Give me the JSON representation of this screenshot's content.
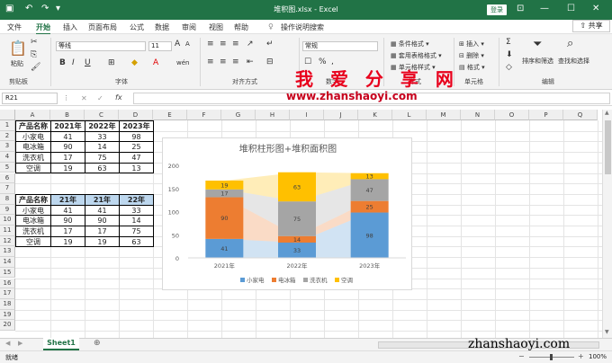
{
  "titlebar": {
    "title": "堆积图.xlsx - Excel",
    "login": "登录"
  },
  "menu": {
    "items": [
      "文件",
      "开始",
      "插入",
      "页面布局",
      "公式",
      "数据",
      "审阅",
      "视图",
      "帮助"
    ],
    "search_placeholder": "操作说明搜索",
    "share": "共享"
  },
  "ribbon": {
    "paste": "粘贴",
    "font_name": "等线",
    "font_size": "11",
    "number_format": "常规",
    "groups": {
      "clipboard": "剪贴板",
      "font": "字体",
      "alignment": "对齐方式",
      "number": "数字",
      "styles": "样式",
      "cells": "单元格",
      "editing": "编辑"
    },
    "cond_format": "条件格式",
    "table_format": "套用表格格式",
    "cell_styles": "单元格样式",
    "insert": "插入",
    "delete": "删除",
    "format": "格式",
    "sort_filter": "排序和筛选",
    "find_select": "查找和选择"
  },
  "formula_bar": {
    "cell": "R21",
    "fx": "fx"
  },
  "columns": [
    "A",
    "B",
    "C",
    "D",
    "E",
    "F",
    "G",
    "H",
    "I",
    "J",
    "K",
    "L",
    "M",
    "N",
    "O",
    "P",
    "Q"
  ],
  "rows": [
    "1",
    "2",
    "3",
    "4",
    "5",
    "6",
    "7",
    "8",
    "9",
    "10",
    "11",
    "12",
    "13",
    "14",
    "15",
    "16",
    "17",
    "18",
    "19",
    "20"
  ],
  "table1": {
    "header": [
      "产品名称",
      "2021年",
      "2022年",
      "2023年"
    ],
    "rows": [
      [
        "小家电",
        "41",
        "33",
        "98"
      ],
      [
        "电冰箱",
        "90",
        "14",
        "25"
      ],
      [
        "洗衣机",
        "17",
        "75",
        "47"
      ],
      [
        "空调",
        "19",
        "63",
        "13"
      ]
    ]
  },
  "table2": {
    "header": [
      "产品名称",
      "21年",
      "21年",
      "22年"
    ],
    "rows": [
      [
        "小家电",
        "41",
        "41",
        "33"
      ],
      [
        "电冰箱",
        "90",
        "90",
        "14"
      ],
      [
        "洗衣机",
        "17",
        "17",
        "75"
      ],
      [
        "空调",
        "19",
        "19",
        "63"
      ]
    ]
  },
  "chart_data": {
    "type": "bar",
    "title": "堆积柱形图+堆积面积图",
    "categories": [
      "2021年",
      "2022年",
      "2023年"
    ],
    "ylim": [
      0,
      200
    ],
    "yticks": [
      "0",
      "50",
      "100",
      "150",
      "200"
    ],
    "series": [
      {
        "name": "小家电",
        "values": [
          41,
          33,
          98
        ],
        "color": "#5b9bd5"
      },
      {
        "name": "电冰箱",
        "values": [
          90,
          14,
          25
        ],
        "color": "#ed7d31"
      },
      {
        "name": "洗衣机",
        "values": [
          17,
          75,
          47
        ],
        "color": "#a5a5a5"
      },
      {
        "name": "空调",
        "values": [
          19,
          63,
          13
        ],
        "color": "#ffc000"
      }
    ],
    "legend": "bottom",
    "grid": false
  },
  "sheet": {
    "tab": "Sheet1"
  },
  "status": {
    "left": "就绪",
    "zoom": "100%"
  },
  "watermark": {
    "text": "我 爱 分 享 网",
    "url": "www.zhanshaoyi.com",
    "url2": "zhanshaoyi.com"
  }
}
